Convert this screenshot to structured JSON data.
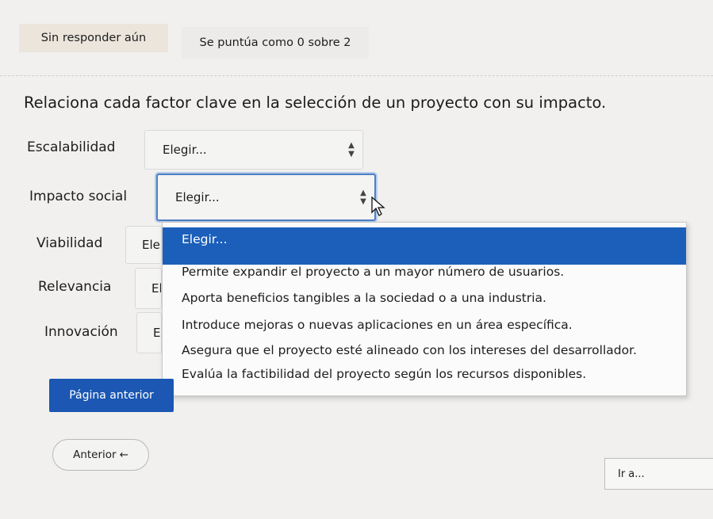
{
  "status": {
    "answer_state": "Sin responder aún",
    "score_label": "Se puntúa como 0 sobre 2"
  },
  "question": {
    "text": "Relaciona cada factor clave en la selección de un proyecto con su impacto."
  },
  "rows": [
    {
      "label": "Escalabilidad",
      "selected": "Elegir..."
    },
    {
      "label": "Impacto social",
      "selected": "Elegir..."
    },
    {
      "label": "Viabilidad",
      "selected": "Ele"
    },
    {
      "label": "Relevancia",
      "selected": "El"
    },
    {
      "label": "Innovación",
      "selected": "El"
    }
  ],
  "dropdown": {
    "options": [
      "Elegir...",
      "Permite expandir el proyecto a un mayor número de usuarios.",
      "Aporta beneficios tangibles a la sociedad o a una industria.",
      "Introduce mejoras o nuevas aplicaciones en un área específica.",
      "Asegura que el proyecto esté alineado con los intereses del desarrollador.",
      "Evalúa la factibilidad del proyecto según los recursos disponibles."
    ]
  },
  "navigation": {
    "prev_page_label": "Página anterior",
    "prev_activity_label": "Anterior",
    "prev_activity_icon": "arrow-left-icon",
    "goto_placeholder": "Ir a..."
  },
  "colors": {
    "primary": "#1b57b3",
    "highlight": "#1b5fba",
    "focus": "#4d7fc2"
  }
}
